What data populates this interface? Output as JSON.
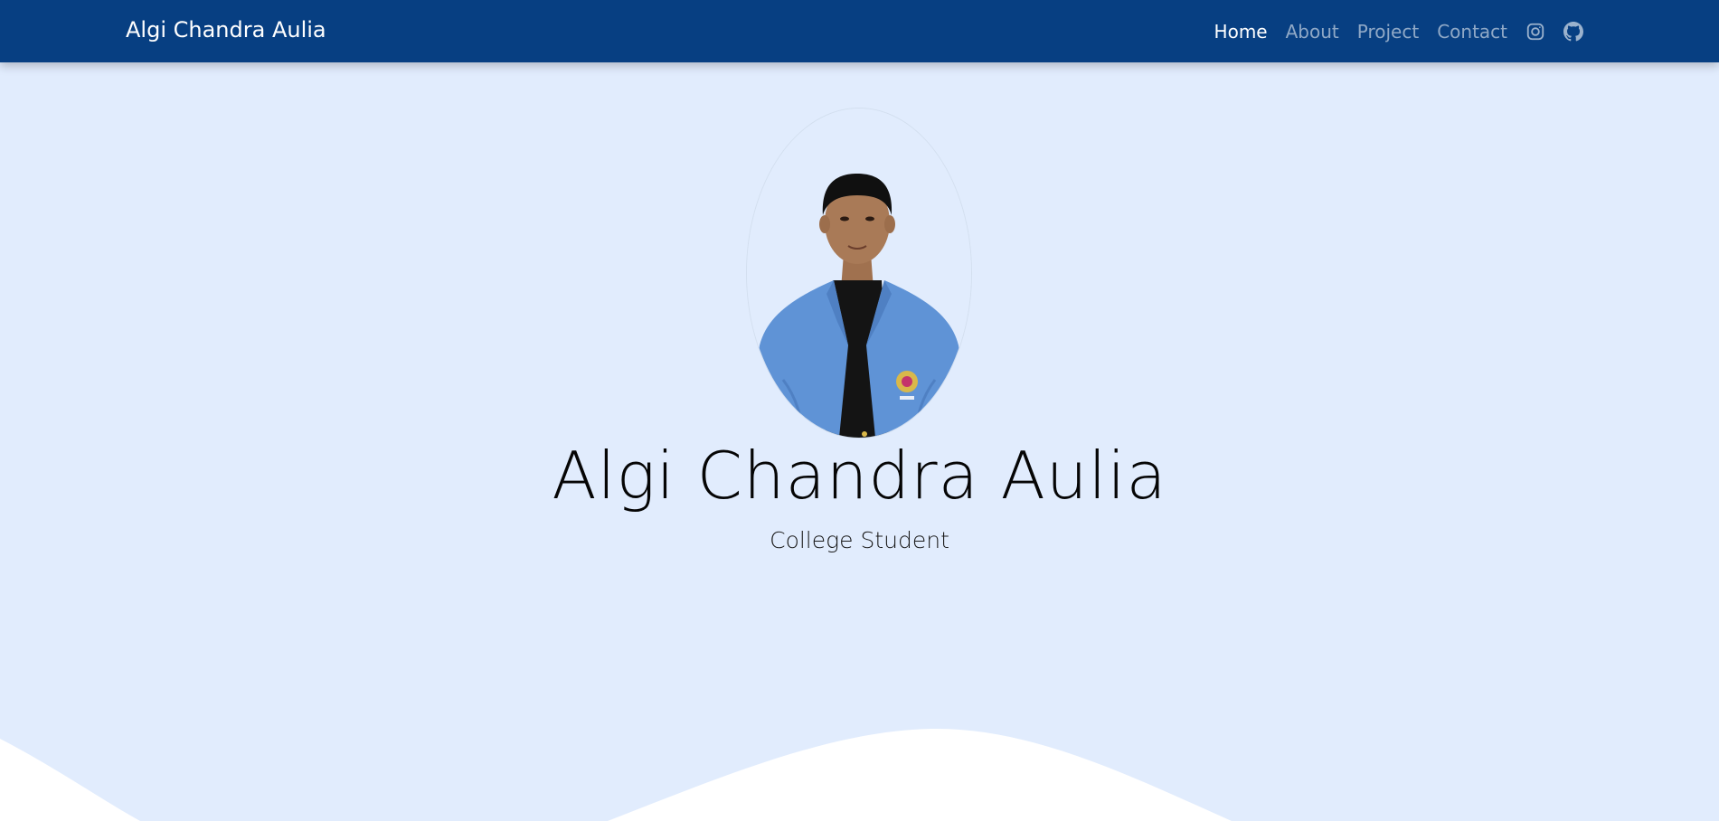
{
  "navbar": {
    "brand": "Algi Chandra Aulia",
    "links": [
      {
        "label": "Home",
        "active": true
      },
      {
        "label": "About",
        "active": false
      },
      {
        "label": "Project",
        "active": false
      },
      {
        "label": "Contact",
        "active": false
      }
    ],
    "icons": [
      "instagram-icon",
      "github-icon"
    ]
  },
  "hero": {
    "name": "Algi Chandra Aulia",
    "role": "College Student"
  },
  "colors": {
    "navbar_bg": "#073f82",
    "page_bg": "#e1ecfd",
    "wave": "#ffffff",
    "blazer": "#5f93d6"
  }
}
